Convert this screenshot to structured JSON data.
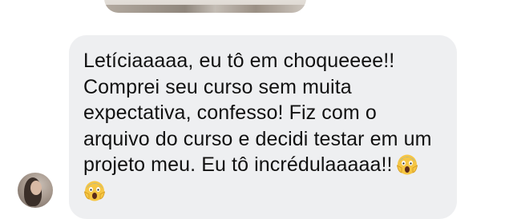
{
  "conversation": {
    "message": {
      "lines": [
        "Letíciaaaaa, eu tô em choqueeee!!",
        "Comprei seu curso sem muita",
        "expectativa, confesso! Fiz com o",
        "arquivo do curso e decidi testar em um",
        "projeto meu. Eu tô incrédulaaaaa!!"
      ],
      "emoji_icon": "face-screaming-in-fear-icon",
      "bubble_color": "#eeeff1",
      "text_color": "#111111"
    }
  }
}
